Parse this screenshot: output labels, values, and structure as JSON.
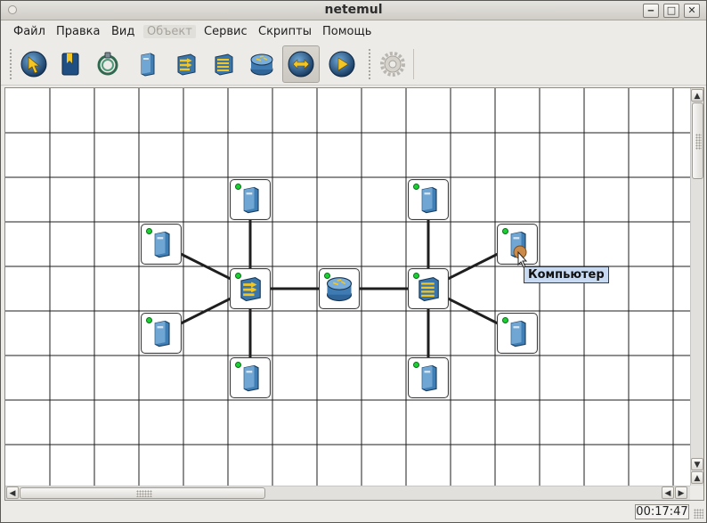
{
  "window": {
    "title": "netemul"
  },
  "menu": {
    "items": [
      {
        "label": "Файл",
        "disabled": false
      },
      {
        "label": "Правка",
        "disabled": false
      },
      {
        "label": "Вид",
        "disabled": false
      },
      {
        "label": "Объект",
        "disabled": true
      },
      {
        "label": "Сервис",
        "disabled": false
      },
      {
        "label": "Скрипты",
        "disabled": false
      },
      {
        "label": "Помощь",
        "disabled": false
      }
    ]
  },
  "toolbar": {
    "tools": [
      {
        "icon": "select-arrow-icon",
        "active": false
      },
      {
        "icon": "note-icon",
        "active": false
      },
      {
        "icon": "cable-icon",
        "active": false
      },
      {
        "icon": "computer-icon",
        "active": false
      },
      {
        "icon": "hub-icon",
        "active": false
      },
      {
        "icon": "switch-icon",
        "active": false
      },
      {
        "icon": "router-icon",
        "active": false
      },
      {
        "icon": "send-icon",
        "active": true
      },
      {
        "icon": "play-icon",
        "active": false
      },
      {
        "icon": "settings-gear-icon",
        "active": false
      }
    ]
  },
  "canvas": {
    "nodes": [
      {
        "type": "computer",
        "status": "on"
      },
      {
        "type": "computer",
        "status": "on"
      },
      {
        "type": "computer",
        "status": "on"
      },
      {
        "type": "computer",
        "status": "on"
      },
      {
        "type": "hub",
        "status": "on"
      },
      {
        "type": "router",
        "status": "on"
      },
      {
        "type": "switch",
        "status": "on"
      },
      {
        "type": "computer",
        "status": "on"
      },
      {
        "type": "computer",
        "status": "on"
      },
      {
        "type": "computer",
        "status": "on"
      },
      {
        "type": "computer",
        "status": "on"
      }
    ],
    "tooltip": "Компьютер"
  },
  "statusbar": {
    "clock": "00:17:47"
  },
  "colors": {
    "led": "#19d130",
    "tooltip_bg": "#c7daf2",
    "grid": "#1e1e1e"
  }
}
